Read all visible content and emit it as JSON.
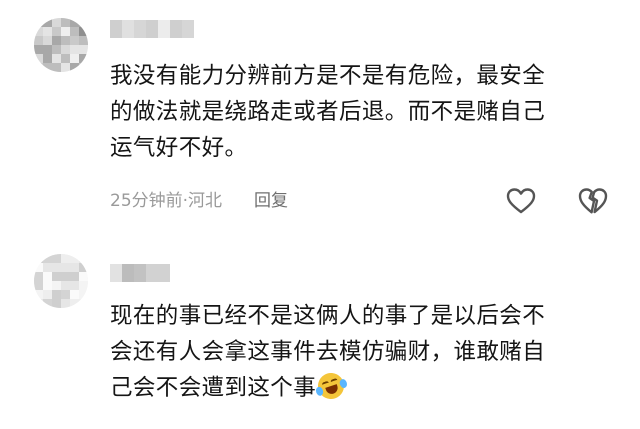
{
  "comments": [
    {
      "username": "",
      "text_lines": [
        "我没有能力分辨前方是不是有危险，最安全",
        "的做法就是绕路走或者后退。而不是赌自己",
        "运气好不好。"
      ],
      "time": "25分钟前",
      "separator": "·",
      "location": "河北",
      "reply_label": "回复",
      "like_icon": "heart-outline-icon",
      "dislike_icon": "broken-heart-icon"
    },
    {
      "username": "",
      "text_lines": [
        "现在的事已经不是这俩人的事了是以后会不",
        "会还有人会拿这事件去模仿骗财，谁敢赌自",
        "己会不会遭到这个事"
      ],
      "emoji": "laughing-crying-emoji"
    }
  ],
  "colors": {
    "text": "#151515",
    "meta": "#9a9a9a",
    "icon": "#555555",
    "background": "#ffffff"
  }
}
